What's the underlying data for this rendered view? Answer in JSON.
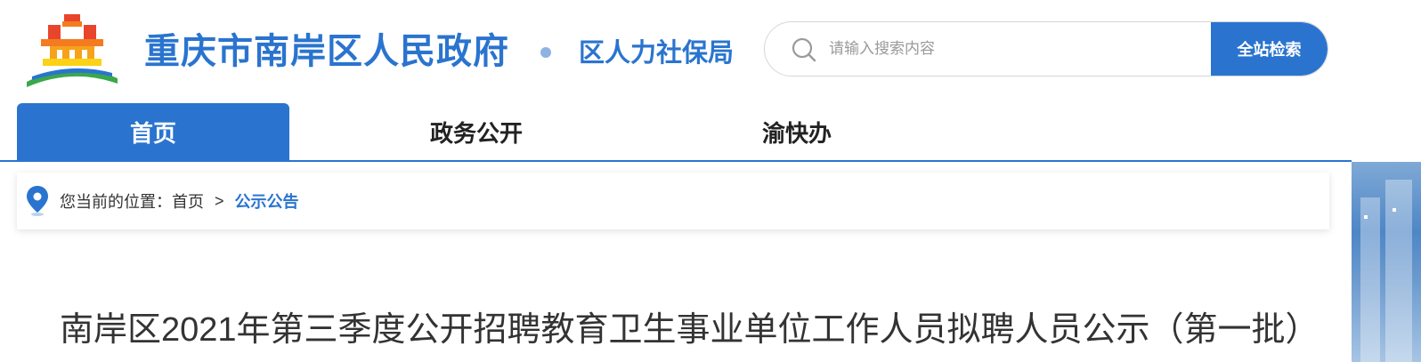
{
  "header": {
    "site_title": "重庆市南岸区人民政府",
    "department": "区人力社保局",
    "logo_icon": "tiananmen-logo-icon"
  },
  "search": {
    "placeholder": "请输入搜索内容",
    "button_label": "全站检索",
    "icon": "search-icon"
  },
  "nav": {
    "items": [
      {
        "label": "首页",
        "active": true
      },
      {
        "label": "政务公开",
        "active": false
      },
      {
        "label": "渝快办",
        "active": false
      }
    ]
  },
  "breadcrumb": {
    "prefix": "您当前的位置：首页",
    "separator": ">",
    "current": "公示公告",
    "icon": "location-pin-icon"
  },
  "article": {
    "title": "南岸区2021年第三季度公开招聘教育卫生事业单位工作人员拟聘人员公示（第一批）"
  },
  "colors": {
    "brand_blue": "#2a74cf",
    "dot": "#8fb2e3"
  }
}
